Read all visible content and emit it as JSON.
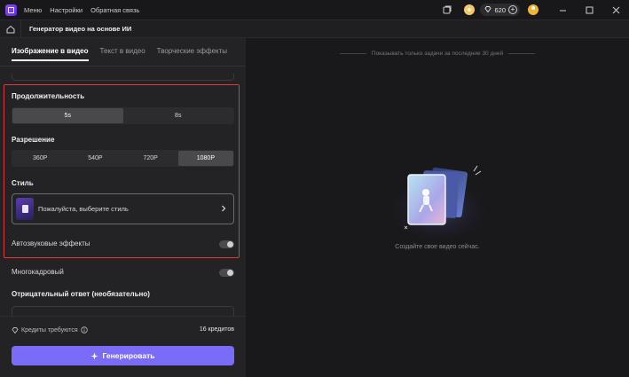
{
  "titlebar": {
    "menu": [
      "Меню",
      "Настройки",
      "Обратная связь"
    ],
    "credits": "620"
  },
  "crumb": {
    "title": "Генератор видео на основе ИИ"
  },
  "tabs": [
    "Изображение в видео",
    "Текст в видео",
    "Творческие эффекты"
  ],
  "duration": {
    "label": "Продолжительность",
    "options": [
      "5s",
      "8s"
    ],
    "selected": "5s"
  },
  "resolution": {
    "label": "Разрешение",
    "options": [
      "360P",
      "540P",
      "720P",
      "1080P"
    ],
    "selected": "1080P"
  },
  "style": {
    "label": "Стиль",
    "placeholder": "Пожалуйста, выберите стиль"
  },
  "auto_sound": {
    "label": "Автозвуковые эффекты",
    "on": false
  },
  "multiframe": {
    "label": "Многокадровый",
    "on": false
  },
  "negative": {
    "label": "Отрицательный ответ (необязательно)"
  },
  "footer": {
    "credits_label": "Кредиты требуются",
    "credits_value": "16 кредитов",
    "generate_label": "Генерировать"
  },
  "right": {
    "notice": "Показывать только задачи за последние 30 дней",
    "empty_text": "Создайте свое видео сейчас."
  },
  "colors": {
    "accent": "#7a6cf7",
    "highlight": "#e0383e"
  }
}
